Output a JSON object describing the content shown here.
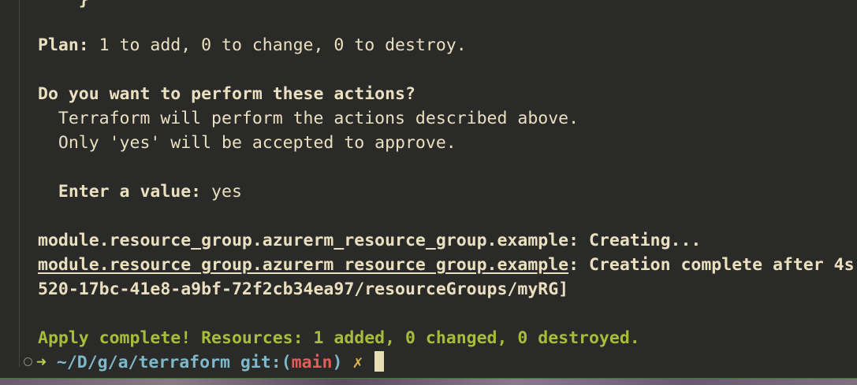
{
  "terminal": {
    "top_partial": "}",
    "plan": {
      "label": "Plan:",
      "rest": " 1 to add, 0 to change, 0 to destroy."
    },
    "question": "Do you want to perform these actions?",
    "info_line_1": "  Terraform will perform the actions described above.",
    "info_line_2": "  Only 'yes' will be accepted to approve.",
    "enter": {
      "label": "  Enter a value:",
      "value": " yes"
    },
    "creating": {
      "resource": "module.resource_group.azurerm_resource_group.example",
      "status": ": Creating..."
    },
    "complete": {
      "resource": "module.resource_group.azurerm_resource_group.example",
      "status": ": Creation complete after 4s"
    },
    "id_tail": "520-17bc-41e8-a9bf-72f2cb34ea97/resourceGroups/myRG]",
    "apply_complete": "Apply complete! Resources: 1 added, 0 changed, 0 destroyed."
  },
  "prompt": {
    "arrow": "➜",
    "cwd": "~/D/g/a/terraform",
    "git_label": "git:",
    "paren_open": "(",
    "branch": "main",
    "paren_close": ")",
    "dirty_mark": "✗"
  },
  "colors": {
    "background": "#2a2a29",
    "foreground": "#eae0c0",
    "green": "#a6bd3a",
    "cyan": "#7eb8c9",
    "red": "#e35d5b",
    "yellow": "#e0b64a"
  }
}
